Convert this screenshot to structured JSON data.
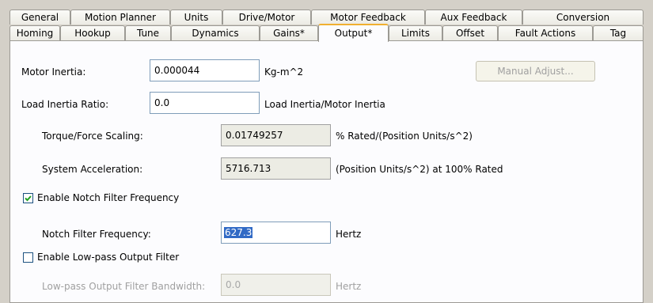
{
  "tabs_row1": [
    "General",
    "Motion Planner",
    "Units",
    "Drive/Motor",
    "Motor Feedback",
    "Aux Feedback",
    "Conversion"
  ],
  "tabs_row2": [
    "Homing",
    "Hookup",
    "Tune",
    "Dynamics",
    "Gains*",
    "Output*",
    "Limits",
    "Offset",
    "Fault Actions",
    "Tag"
  ],
  "active_tab": "Output*",
  "motor_inertia": {
    "label": "Motor Inertia:",
    "value": "0.000044",
    "unit": "Kg-m^2"
  },
  "manual_adjust_label": "Manual Adjust...",
  "load_inertia_ratio": {
    "label": "Load Inertia Ratio:",
    "value": "0.0",
    "unit": "Load Inertia/Motor Inertia"
  },
  "torque_force_scaling": {
    "label": "Torque/Force Scaling:",
    "value": "0.01749257",
    "unit": "% Rated/(Position Units/s^2)"
  },
  "system_acceleration": {
    "label": "System Acceleration:",
    "value": "5716.713",
    "unit": "(Position Units/s^2) at 100% Rated"
  },
  "notch_filter_enable": {
    "label": "Enable Notch Filter Frequency",
    "checked": true
  },
  "notch_filter_frequency": {
    "label": "Notch Filter Frequency:",
    "value": "627.3",
    "unit": "Hertz"
  },
  "lowpass_enable": {
    "label": "Enable Low-pass Output Filter",
    "checked": false
  },
  "lowpass_bandwidth": {
    "label": "Low-pass Output Filter Bandwidth:",
    "value": "0.0",
    "unit": "Hertz"
  }
}
